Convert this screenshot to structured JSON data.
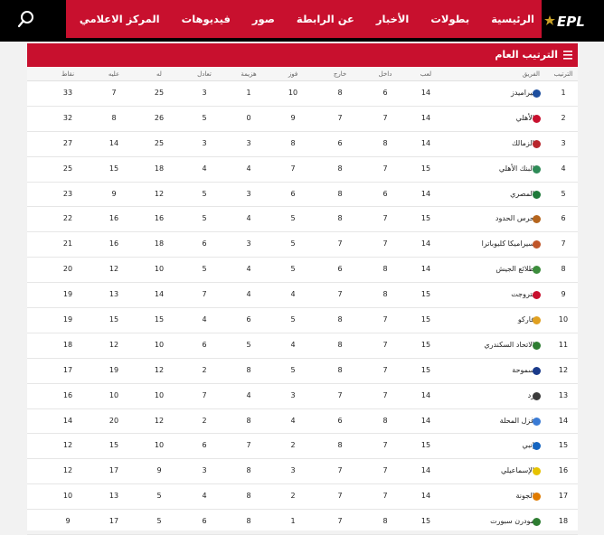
{
  "nav": {
    "logo_text": "EPL",
    "items": [
      "الرئيسية",
      "بطولات",
      "الأخبار",
      "عن الرابطة",
      "صور",
      "فيديوهات",
      "المركز الاعلامي"
    ]
  },
  "panel": {
    "title": "الترتيب العام"
  },
  "table": {
    "headers": {
      "rank": "الترتيب",
      "team": "الفريق",
      "played": "لعب",
      "home": "داخل",
      "away": "خارج",
      "win": "فوز",
      "loss": "هزيمة",
      "draw": "تعادل",
      "for": "له",
      "against": "عليه",
      "pts": "نقاط"
    },
    "rows": [
      {
        "rank": "1",
        "team": "بيراميدز",
        "played": "14",
        "home": "6",
        "away": "8",
        "win": "10",
        "loss": "1",
        "draw": "3",
        "for": "25",
        "against": "7",
        "pts": "33",
        "color": "#1d4e9e"
      },
      {
        "rank": "2",
        "team": "الأهلي",
        "played": "14",
        "home": "7",
        "away": "7",
        "win": "9",
        "loss": "0",
        "draw": "5",
        "for": "26",
        "against": "8",
        "pts": "32",
        "color": "#c8102e"
      },
      {
        "rank": "3",
        "team": "الزمالك",
        "played": "14",
        "home": "8",
        "away": "6",
        "win": "8",
        "loss": "3",
        "draw": "3",
        "for": "25",
        "against": "14",
        "pts": "27",
        "color": "#b8262c"
      },
      {
        "rank": "4",
        "team": "البنك الأهلي",
        "played": "15",
        "home": "7",
        "away": "8",
        "win": "7",
        "loss": "4",
        "draw": "4",
        "for": "18",
        "against": "15",
        "pts": "25",
        "color": "#2e8b57"
      },
      {
        "rank": "5",
        "team": "المصري",
        "played": "14",
        "home": "6",
        "away": "8",
        "win": "6",
        "loss": "3",
        "draw": "5",
        "for": "12",
        "against": "9",
        "pts": "23",
        "color": "#1f7a3a"
      },
      {
        "rank": "6",
        "team": "حرس الحدود",
        "played": "15",
        "home": "7",
        "away": "8",
        "win": "5",
        "loss": "4",
        "draw": "5",
        "for": "16",
        "against": "16",
        "pts": "22",
        "color": "#b5651d"
      },
      {
        "rank": "7",
        "team": "سيراميكا كليوباترا",
        "played": "14",
        "home": "7",
        "away": "7",
        "win": "5",
        "loss": "3",
        "draw": "6",
        "for": "18",
        "against": "16",
        "pts": "21",
        "color": "#c0562a"
      },
      {
        "rank": "8",
        "team": "طلائع الجيش",
        "played": "14",
        "home": "8",
        "away": "6",
        "win": "5",
        "loss": "4",
        "draw": "5",
        "for": "10",
        "against": "12",
        "pts": "20",
        "color": "#3c8d3c"
      },
      {
        "rank": "9",
        "team": "بتروجت",
        "played": "15",
        "home": "8",
        "away": "7",
        "win": "4",
        "loss": "4",
        "draw": "7",
        "for": "14",
        "against": "13",
        "pts": "19",
        "color": "#c8102e"
      },
      {
        "rank": "10",
        "team": "فاركو",
        "played": "15",
        "home": "7",
        "away": "8",
        "win": "5",
        "loss": "6",
        "draw": "4",
        "for": "15",
        "against": "15",
        "pts": "19",
        "color": "#e0a020"
      },
      {
        "rank": "11",
        "team": "الاتحاد السكندري",
        "played": "15",
        "home": "7",
        "away": "8",
        "win": "4",
        "loss": "5",
        "draw": "6",
        "for": "10",
        "against": "12",
        "pts": "18",
        "color": "#2e7d32"
      },
      {
        "rank": "12",
        "team": "سموحة",
        "played": "15",
        "home": "7",
        "away": "8",
        "win": "5",
        "loss": "8",
        "draw": "2",
        "for": "12",
        "against": "19",
        "pts": "17",
        "color": "#1a3a8a"
      },
      {
        "rank": "13",
        "team": "زد",
        "played": "14",
        "home": "7",
        "away": "7",
        "win": "3",
        "loss": "4",
        "draw": "7",
        "for": "10",
        "against": "10",
        "pts": "16",
        "color": "#3a3a3a"
      },
      {
        "rank": "14",
        "team": "غزل المحلة",
        "played": "14",
        "home": "8",
        "away": "6",
        "win": "4",
        "loss": "8",
        "draw": "2",
        "for": "12",
        "against": "20",
        "pts": "14",
        "color": "#3a7bd5"
      },
      {
        "rank": "15",
        "team": "إنبي",
        "played": "15",
        "home": "7",
        "away": "8",
        "win": "2",
        "loss": "7",
        "draw": "6",
        "for": "10",
        "against": "15",
        "pts": "12",
        "color": "#1565c0"
      },
      {
        "rank": "16",
        "team": "الإسماعيلي",
        "played": "14",
        "home": "7",
        "away": "7",
        "win": "3",
        "loss": "8",
        "draw": "3",
        "for": "9",
        "against": "17",
        "pts": "12",
        "color": "#e6c200"
      },
      {
        "rank": "17",
        "team": "الجونة",
        "played": "14",
        "home": "7",
        "away": "7",
        "win": "2",
        "loss": "8",
        "draw": "4",
        "for": "5",
        "against": "13",
        "pts": "10",
        "color": "#e07b00"
      },
      {
        "rank": "18",
        "team": "مودرن سبورت",
        "played": "15",
        "home": "8",
        "away": "7",
        "win": "1",
        "loss": "8",
        "draw": "6",
        "for": "5",
        "against": "17",
        "pts": "9",
        "color": "#2e7d32"
      }
    ]
  }
}
